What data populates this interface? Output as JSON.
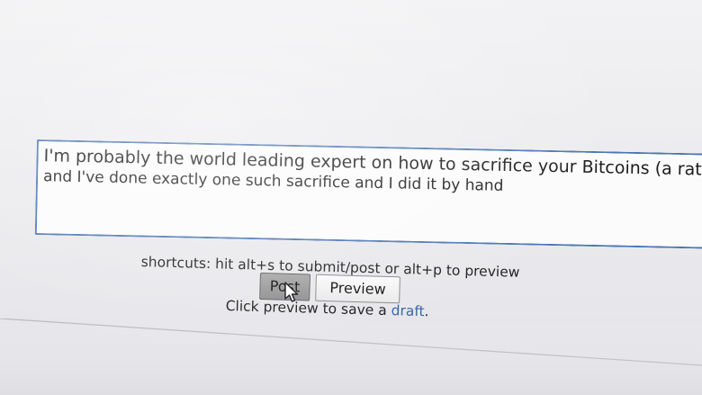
{
  "comment": {
    "line1": "I'm probably the world leading expert on how to sacrifice your Bitcoins (a rather du",
    "line2": "and I've done exactly one such sacrifice and I did it by hand"
  },
  "shortcuts_text": "shortcuts: hit alt+s to submit/post or alt+p to preview",
  "buttons": {
    "post_label": "Post",
    "preview_label": "Preview"
  },
  "draft_line": {
    "prefix": "Click preview to save a ",
    "link": "draft",
    "suffix": "."
  },
  "colors": {
    "textarea_border": "#4a75b4",
    "link": "#3563a8"
  },
  "icons": {
    "cursor": "hand-pointer-icon"
  }
}
